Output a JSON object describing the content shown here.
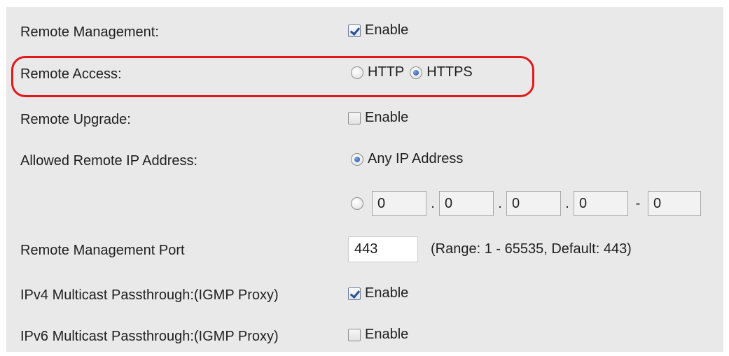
{
  "remote_management": {
    "label": "Remote Management:",
    "enabled": true,
    "checkbox_label": "Enable"
  },
  "remote_access": {
    "label": "Remote Access:",
    "http_label": "HTTP",
    "https_label": "HTTPS",
    "selected": "HTTPS"
  },
  "remote_upgrade": {
    "label": "Remote Upgrade:",
    "enabled": false,
    "checkbox_label": "Enable"
  },
  "allowed_remote_ip": {
    "label": "Allowed Remote IP Address:",
    "any_ip_label": "Any IP Address",
    "any_ip_selected": true,
    "range_fields": [
      "0",
      "0",
      "0",
      "0",
      "0"
    ],
    "dot": ".",
    "dash": "-"
  },
  "remote_management_port": {
    "label": "Remote Management Port",
    "value": "443",
    "hint": "(Range: 1 - 65535, Default: 443)"
  },
  "ipv4_multicast": {
    "label": "IPv4 Multicast Passthrough:(IGMP Proxy)",
    "enabled": true,
    "checkbox_label": "Enable"
  },
  "ipv6_multicast": {
    "label": "IPv6 Multicast Passthrough:(IGMP Proxy)",
    "enabled": false,
    "checkbox_label": "Enable"
  },
  "colors": {
    "panel_bg": "#e9e9e9",
    "highlight_border": "#e0191d",
    "check_color": "#2c4f8f"
  }
}
